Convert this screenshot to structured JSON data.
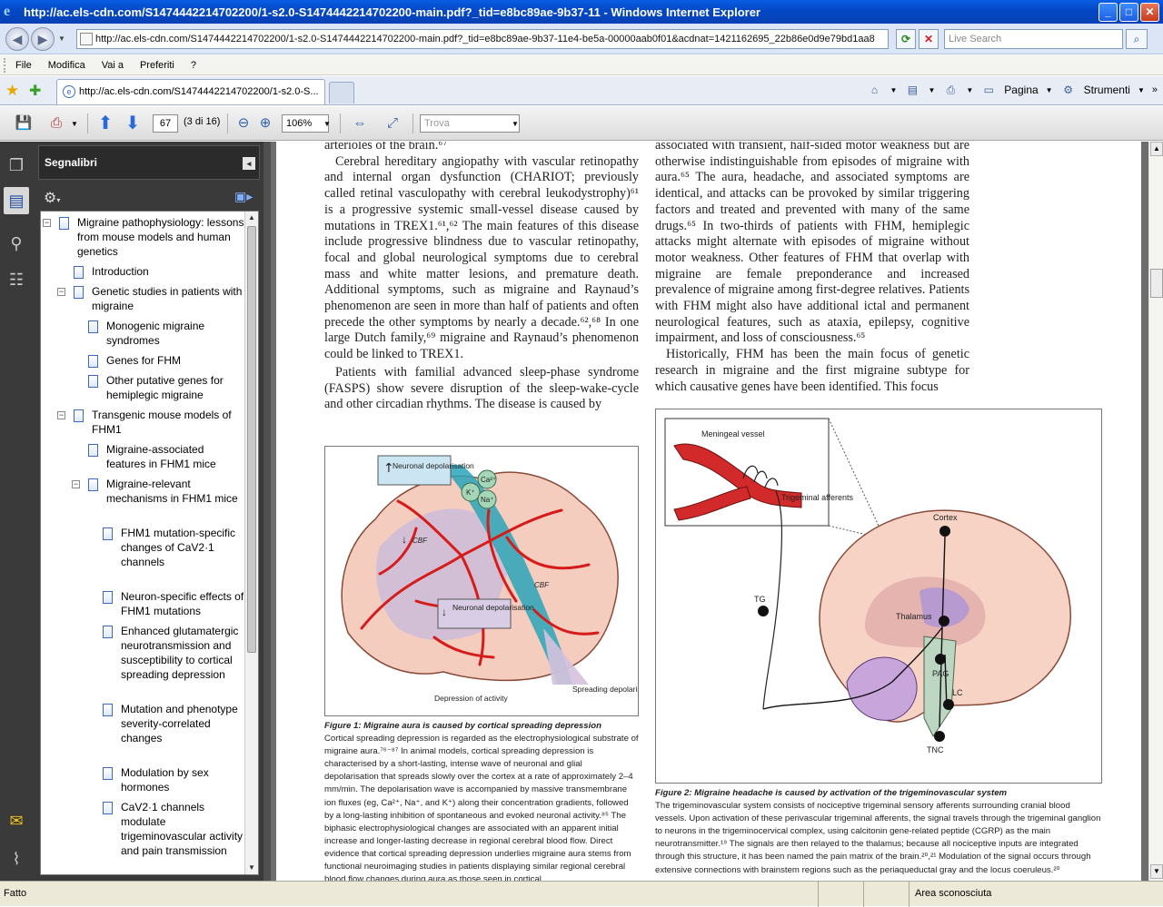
{
  "window": {
    "title": "http://ac.els-cdn.com/S1474442214702200/1-s2.0-S1474442214702200-main.pdf?_tid=e8bc89ae-9b37-11 - Windows Internet Explorer",
    "minimize": "_",
    "maximize": "□",
    "close": "✕"
  },
  "address": {
    "url": "http://ac.els-cdn.com/S1474442214702200/1-s2.0-S1474442214702200-main.pdf?_tid=e8bc89ae-9b37-11e4-be5a-00000aab0f01&acdnat=1421162695_22b86e0d9e79bd1aa8",
    "search_placeholder": "Live Search"
  },
  "menu": [
    "File",
    "Modifica",
    "Vai a",
    "Preferiti",
    "?"
  ],
  "tab": {
    "label": "http://ac.els-cdn.com/S1474442214702200/1-s2.0-S..."
  },
  "tab_tools": {
    "page": "Pagina",
    "tools": "Strumenti"
  },
  "pdf_toolbar": {
    "page_number": "67",
    "page_count": "(3 di 16)",
    "zoom": "106%",
    "find_placeholder": "Trova"
  },
  "bookmarks": {
    "header": "Segnalibri",
    "items": [
      {
        "label": "Migraine pathophysiology: lessons from mouse models and human genetics"
      },
      {
        "label": "Introduction"
      },
      {
        "label": "Genetic studies in patients with migraine"
      },
      {
        "label": "Monogenic migraine syndromes"
      },
      {
        "label": "Genes for FHM"
      },
      {
        "label": "Other putative genes for hemiplegic migraine"
      },
      {
        "label": "Transgenic mouse models of FHM1"
      },
      {
        "label": "Migraine-associated features in FHM1 mice"
      },
      {
        "label": "Migraine-relevant mechanisms in FHM1 mice"
      },
      {
        "label": "FHM1 mutation-specific changes of CaV2·1 channels"
      },
      {
        "label": "Neuron-specific effects of FHM1 mutations"
      },
      {
        "label": "Enhanced glutamatergic neurotransmission and susceptibility to cortical spreading depression"
      },
      {
        "label": "Mutation and phenotype severity-correlated changes"
      },
      {
        "label": "Modulation by sex hormones"
      },
      {
        "label": "CaV2·1 channels modulate trigeminovascular activity and pain transmission"
      }
    ]
  },
  "document": {
    "left_col_top": "arterioles of the brain.⁶⁷",
    "left_p1": "Cerebral hereditary angiopathy with vascular retinopathy and internal organ dysfunction (CHARIOT; previously called retinal vasculopathy with cerebral leukodystrophy)⁶¹ is a progressive systemic small-vessel disease caused by mutations in TREX1.⁶¹,⁶² The main features of this disease include progressive blindness due to vascular retinopathy, focal and global neurological symptoms due to cerebral mass and white matter lesions, and premature death. Additional symptoms, such as migraine and Raynaud’s phenomenon are seen in more than half of patients and often precede the other symptoms by nearly a decade.⁶²,⁶⁸ In one large Dutch family,⁶⁹ migraine and Raynaud’s phenomenon could be linked to TREX1.",
    "left_p2": "Patients with familial advanced sleep-phase syndrome (FASPS) show severe disruption of the sleep-wake-cycle and other circadian rhythms. The disease is caused by",
    "right_p1": "associated with transient, half-sided motor weakness but are otherwise indistinguishable from episodes of migraine with aura.⁶⁵ The aura, headache, and associated symptoms are identical, and attacks can be provoked by similar triggering factors and treated and prevented with many of the same drugs.⁶⁵ In two-thirds of patients with FHM, hemiplegic attacks might alternate with episodes of migraine without motor weakness. Other features of FHM that overlap with migraine are female preponderance and increased prevalence of migraine among first-degree relatives. Patients with FHM might also have additional ictal and permanent neurological features, such as ataxia, epilepsy, cognitive impairment, and loss of consciousness.⁶⁵",
    "right_p2": "Historically, FHM has been the main focus of genetic research in migraine and the first migraine subtype for which causative genes have been identified. This focus",
    "fig1": {
      "label_neuronal_depol_top": "Neuronal depolarisation",
      "label_ca": "Ca²⁺",
      "label_k": "K⁺",
      "label_na": "Na⁺",
      "label_cbf_left": "CBF",
      "label_cbf_right": "CBF",
      "label_neuronal_depol_mid": "Neuronal depolarisation",
      "label_depression": "Depression of activity",
      "label_spreading": "Spreading depolarisation",
      "caption_title": "Figure 1: Migraine aura is caused by cortical spreading depression",
      "caption_body": "Cortical spreading depression is regarded as the electrophysiological substrate of migraine aura.⁷⁶⁻⁸⁷ In animal models, cortical spreading depression is characterised by a short-lasting, intense wave of neuronal and glial depolarisation that spreads slowly over the cortex at a rate of approximately 2–4 mm/min. The depolarisation wave is accompanied by massive transmembrane ion fluxes (eg, Ca²⁺, Na⁺, and K⁺) along their concentration gradients, followed by a long-lasting inhibition of spontaneous and evoked neuronal activity.⁸⁵ The biphasic electrophysiological changes are associated with an apparent initial increase and longer-lasting decrease in regional cerebral blood flow. Direct evidence that cortical spreading depression underlies migraine aura stems from functional neuroimaging studies in patients displaying similar regional cerebral blood flow changes during aura as those seen in cortical"
    },
    "fig2": {
      "label_meningeal": "Meningeal vessel",
      "label_trigeminal": "Trigeminal afferents",
      "label_cortex": "Cortex",
      "label_tg": "TG",
      "label_thalamus": "Thalamus",
      "label_pag": "PAG",
      "label_lc": "LC",
      "label_tnc": "TNC",
      "caption_title": "Figure 2: Migraine headache is caused by activation of the trigeminovascular system",
      "caption_body": "The trigeminovascular system consists of nociceptive trigeminal sensory afferents surrounding cranial blood vessels. Upon activation of these perivascular trigeminal afferents, the signal travels through the trigeminal ganglion to neurons in the trigeminocervical complex, using calcitonin gene-related peptide (CGRP) as the main neurotransmitter.¹⁹ The signals are then relayed to the thalamus; because all nociceptive inputs are integrated through this structure, it has been named the pain matrix of the brain.²⁰,²¹ Modulation of the signal occurs through extensive connections with brainstem regions such as the periaqueductal gray and the locus coeruleus.²⁰"
    }
  },
  "status": {
    "left": "Fatto",
    "zone": "Area sconosciuta"
  }
}
